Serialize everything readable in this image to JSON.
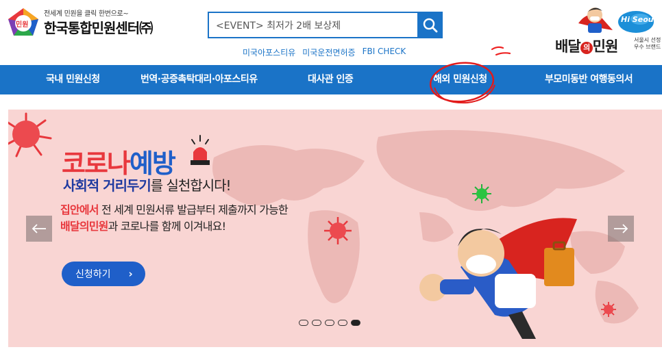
{
  "header": {
    "logo_tagline": "전세계 민원을 클릭 한번으로~",
    "logo_name": "한국통합민원센터㈜",
    "logo_badge": "민원",
    "search_value": "<EVENT> 최저가 2배 보상제",
    "quick_links": [
      "미국아포스티유",
      "미국운전면허증",
      "FBI CHECK"
    ],
    "brand_name_pre": "배달",
    "brand_name_mid": "의",
    "brand_name_post": "민원",
    "brand_sub_1": "서울시 선정",
    "brand_sub_2": "우수 브랜드",
    "hi_seoul": "Hi Seoul"
  },
  "nav": {
    "items": [
      "국내 민원신청",
      "번역·공증촉탁대리·아포스티유",
      "대사관 인증",
      "해외 민원신청",
      "부모미동반 여행동의서"
    ]
  },
  "banner": {
    "title_red": "코로나",
    "title_blue": "예방",
    "subtitle_bold": "사회적 거리두기",
    "subtitle_rest": "를 실천합시다!",
    "desc1_bold": "집안에서",
    "desc1_rest": " 전 세계 민원서류 발급부터 제출까지 가능한",
    "desc2_bold": "배달의민원",
    "desc2_rest": "과 코로나를 함께 이겨내요!",
    "button_label": "신청하기",
    "slide_count": 5,
    "active_slide": 5
  },
  "colors": {
    "primary_blue": "#1a73c7",
    "banner_bg": "#f9d5d3",
    "accent_red": "#e8383d"
  }
}
